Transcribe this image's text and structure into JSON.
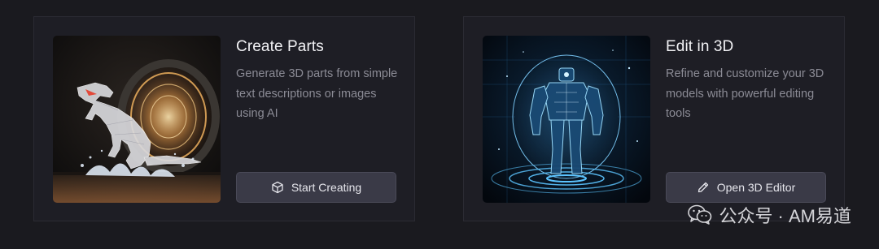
{
  "cards": [
    {
      "title": "Create Parts",
      "description": "Generate 3D parts from simple text descriptions or images using AI",
      "button": {
        "label": "Start Creating",
        "icon": "cube-icon"
      },
      "image": "dinosaur-emerging-from-portal-image"
    },
    {
      "title": "Edit in 3D",
      "description": "Refine and customize your 3D models with powerful editing tools",
      "button": {
        "label": "Open 3D Editor",
        "icon": "pencil-icon"
      },
      "image": "holographic-robot-image"
    }
  ],
  "watermark": {
    "text": "公众号 · AM易道",
    "icon": "wechat-icon"
  },
  "colors": {
    "background": "#1a1a1f",
    "card": "#1e1e25",
    "button": "#3a3a47",
    "title": "#f2f2f5",
    "description": "#8b8b95",
    "hologram": "#4fb8ff",
    "portal": "#f5a24a"
  }
}
